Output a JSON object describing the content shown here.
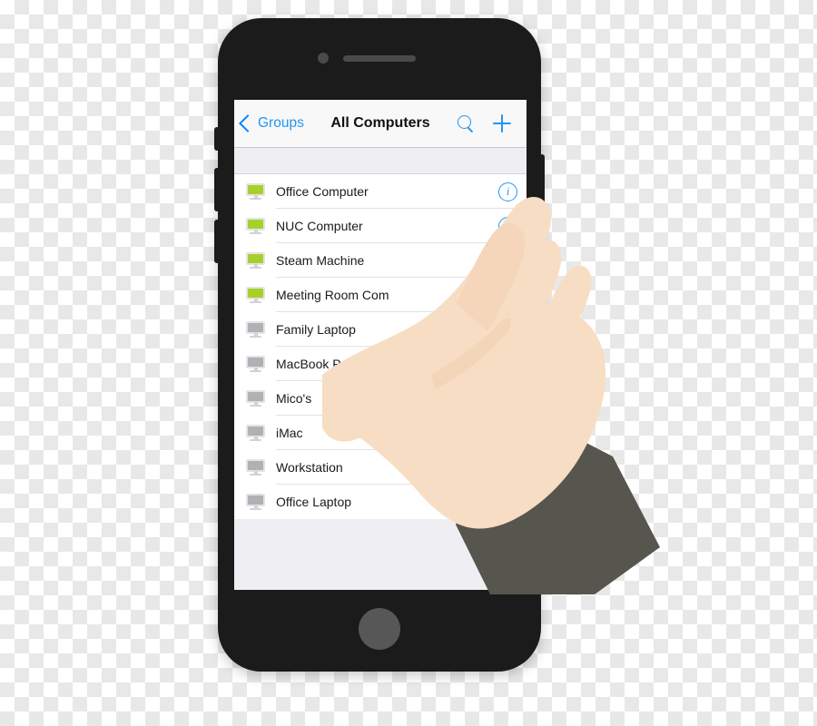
{
  "device": {
    "name": "smartphone-mockup",
    "frame_color": "#1b1b1b",
    "home_button_color": "#575757",
    "parts": {
      "camera": "camera-dot",
      "speaker": "earpiece-speaker",
      "mute_switch": "mute-switch",
      "volume_up": "volume-up-button",
      "volume_down": "volume-down-button",
      "power": "power-button",
      "home": "home-button"
    }
  },
  "app": {
    "navbar": {
      "back_label": "Groups",
      "back_icon": "chevron-left-icon",
      "title": "All Computers",
      "search_icon": "search-icon",
      "add_icon": "plus-icon",
      "accent_color": "#2196f3",
      "background_color": "#f8f8f8"
    },
    "list": {
      "online_color": "#a7d12a",
      "offline_color": "#b0b0b5",
      "info_label": "i",
      "items": [
        {
          "label": "Office Computer",
          "status": "online",
          "icon": "monitor-icon",
          "has_info": true
        },
        {
          "label": "NUC Computer",
          "status": "online",
          "icon": "monitor-icon",
          "has_info": true
        },
        {
          "label": "Steam Machine",
          "status": "online",
          "icon": "monitor-icon",
          "has_info": true
        },
        {
          "label": "Meeting Room Com",
          "status": "online",
          "icon": "monitor-icon",
          "has_info": false
        },
        {
          "label": "Family Laptop",
          "status": "offline",
          "icon": "monitor-icon",
          "has_info": false
        },
        {
          "label": "MacBook Pro",
          "status": "offline",
          "icon": "monitor-icon",
          "has_info": false
        },
        {
          "label": "Mico's",
          "status": "offline",
          "icon": "monitor-icon",
          "has_info": false
        },
        {
          "label": "iMac",
          "status": "offline",
          "icon": "monitor-icon",
          "has_info": false
        },
        {
          "label": "Workstation",
          "status": "offline",
          "icon": "monitor-icon",
          "has_info": false
        },
        {
          "label": "Office Laptop",
          "status": "offline",
          "icon": "monitor-icon",
          "has_info": false
        }
      ]
    },
    "empty_area_color": "#eeeef3"
  },
  "overlay": {
    "hand": {
      "name": "pointing-hand",
      "skin_color": "#f7ddc3",
      "skin_shadow_color": "#efcdaa",
      "sleeve_color": "#56564e",
      "gesture": "index-finger-tap",
      "target_item": "Office Computer"
    }
  }
}
